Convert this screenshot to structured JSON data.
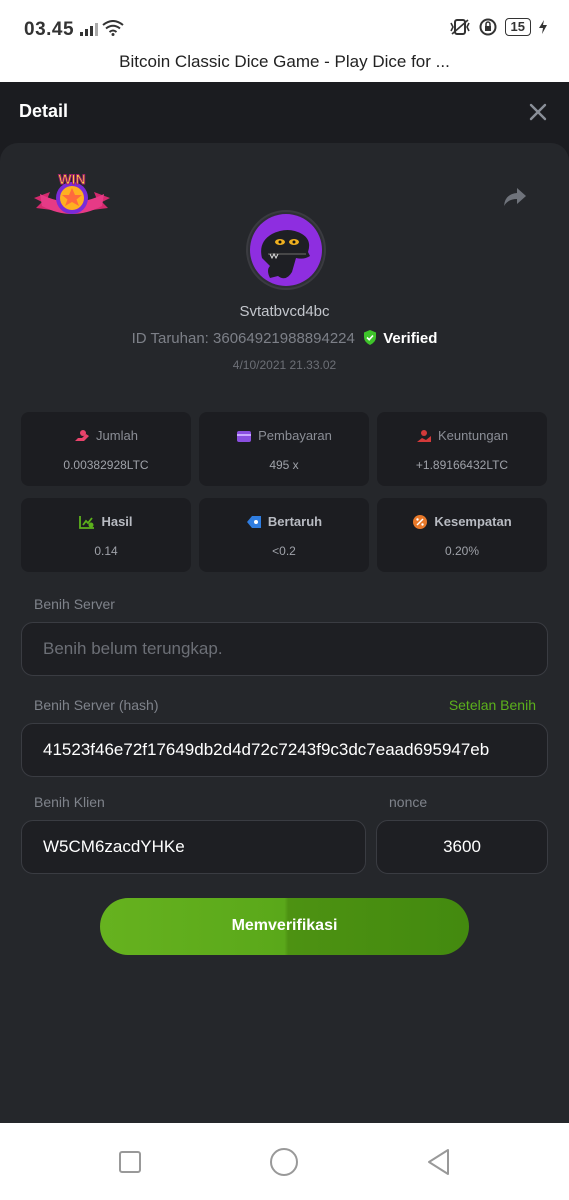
{
  "status_bar": {
    "time": "03.45",
    "battery": "15"
  },
  "browser": {
    "page_title": "Bitcoin Classic Dice Game - Play Dice for ..."
  },
  "header": {
    "title": "Detail",
    "close_icon": "close-icon"
  },
  "bet": {
    "badge": "WIN",
    "username": "Svtatbvcd4bc",
    "id_label": "ID Taruhan:",
    "id_value": "36064921988894224",
    "verified_label": "Verified",
    "datetime": "4/10/2021 21.33.02"
  },
  "stats": [
    {
      "label": "Jumlah",
      "value": "0.00382928LTC",
      "icon": "coins-icon",
      "color": "#e8436b"
    },
    {
      "label": "Pembayaran",
      "value": "495 x",
      "icon": "wallet-icon",
      "color": "#8a4fe0"
    },
    {
      "label": "Keuntungan",
      "value": "+1.89166432LTC",
      "icon": "profit-icon",
      "color": "#d33a3a"
    },
    {
      "label": "Hasil",
      "value": "0.14",
      "icon": "chart-check-icon",
      "color": "#5cb11c"
    },
    {
      "label": "Bertaruh",
      "value": "<0.2",
      "icon": "tag-icon",
      "color": "#2f7de0"
    },
    {
      "label": "Kesempatan",
      "value": "0.20%",
      "icon": "percent-icon",
      "color": "#e8792a"
    }
  ],
  "seeds": {
    "server_label": "Benih Server",
    "server_placeholder": "Benih belum terungkap.",
    "server_hash_label": "Benih Server (hash)",
    "seed_settings_link": "Setelan Benih",
    "server_hash_value": "41523f46e72f17649db2d4d72c7243f9c3dc7eaad695947eb",
    "client_label": "Benih Klien",
    "client_value": "W5CM6zacdYHKe",
    "nonce_label": "nonce",
    "nonce_value": "3600"
  },
  "actions": {
    "verify_label": "Memverifikasi"
  },
  "colors": {
    "accent_green": "#5cb11c",
    "panel_bg": "#25272b",
    "page_bg": "#1b1c20"
  }
}
